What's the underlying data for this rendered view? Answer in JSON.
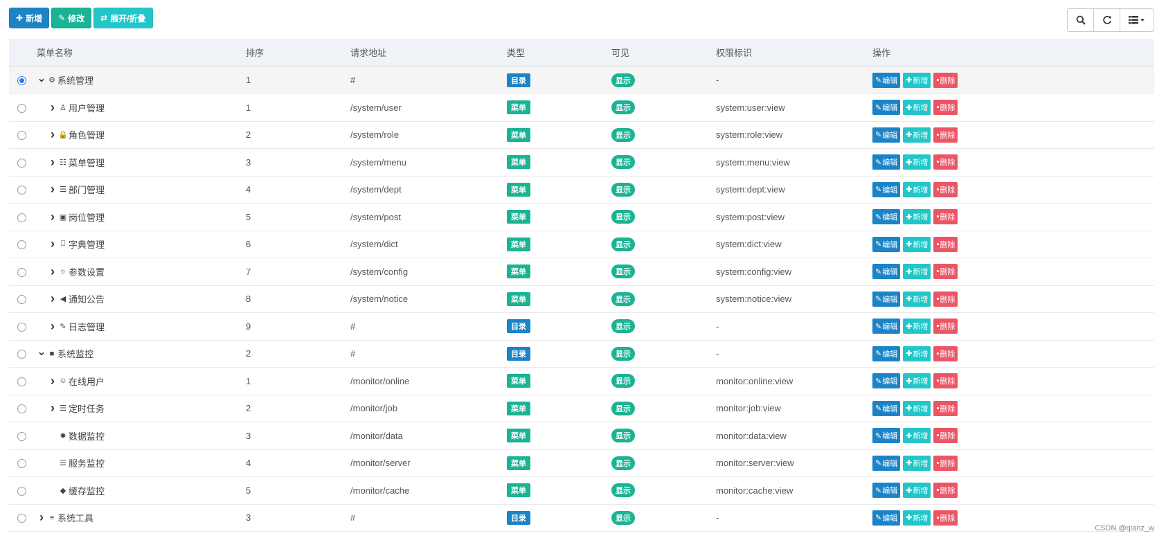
{
  "toolbar": {
    "add_label": "新增",
    "edit_label": "修改",
    "expand_label": "展开/折叠"
  },
  "right_tools": {
    "search_icon": "search-icon",
    "refresh_icon": "refresh-icon",
    "columns_icon": "columns-icon"
  },
  "columns": [
    "菜单名称",
    "排序",
    "请求地址",
    "类型",
    "可见",
    "权限标识",
    "操作"
  ],
  "actions": {
    "edit": "编辑",
    "add": "新增",
    "delete": "删除"
  },
  "rows": [
    {
      "level": 0,
      "toggle": "down",
      "icon": "gear-icon",
      "glyph": "⚙",
      "name": "系统管理",
      "order": "1",
      "url": "#",
      "type": "目录",
      "visible": "显示",
      "perm": "-",
      "selected": true
    },
    {
      "level": 1,
      "toggle": "right",
      "icon": "user-icon",
      "glyph": "♙",
      "name": "用户管理",
      "order": "1",
      "url": "/system/user",
      "type": "菜单",
      "visible": "显示",
      "perm": "system:user:view"
    },
    {
      "level": 1,
      "toggle": "right",
      "icon": "lock-icon",
      "glyph": "🔒",
      "name": "角色管理",
      "order": "2",
      "url": "/system/role",
      "type": "菜单",
      "visible": "显示",
      "perm": "system:role:view"
    },
    {
      "level": 1,
      "toggle": "right",
      "icon": "th-list-icon",
      "glyph": "☷",
      "name": "菜单管理",
      "order": "3",
      "url": "/system/menu",
      "type": "菜单",
      "visible": "显示",
      "perm": "system:menu:view"
    },
    {
      "level": 1,
      "toggle": "right",
      "icon": "outdent-icon",
      "glyph": "☰",
      "name": "部门管理",
      "order": "4",
      "url": "/system/dept",
      "type": "菜单",
      "visible": "显示",
      "perm": "system:dept:view"
    },
    {
      "level": 1,
      "toggle": "right",
      "icon": "id-card-icon",
      "glyph": "▣",
      "name": "岗位管理",
      "order": "5",
      "url": "/system/post",
      "type": "菜单",
      "visible": "显示",
      "perm": "system:post:view"
    },
    {
      "level": 1,
      "toggle": "right",
      "icon": "bookmark-icon",
      "glyph": "⎕",
      "name": "字典管理",
      "order": "6",
      "url": "/system/dict",
      "type": "菜单",
      "visible": "显示",
      "perm": "system:dict:view"
    },
    {
      "level": 1,
      "toggle": "right",
      "icon": "sun-icon",
      "glyph": "☼",
      "name": "参数设置",
      "order": "7",
      "url": "/system/config",
      "type": "菜单",
      "visible": "显示",
      "perm": "system:config:view"
    },
    {
      "level": 1,
      "toggle": "right",
      "icon": "bullhorn-icon",
      "glyph": "◀",
      "name": "通知公告",
      "order": "8",
      "url": "/system/notice",
      "type": "菜单",
      "visible": "显示",
      "perm": "system:notice:view"
    },
    {
      "level": 1,
      "toggle": "right",
      "icon": "edit-icon",
      "glyph": "✎",
      "name": "日志管理",
      "order": "9",
      "url": "#",
      "type": "目录",
      "visible": "显示",
      "perm": "-"
    },
    {
      "level": 0,
      "toggle": "down",
      "icon": "video-camera-icon",
      "glyph": "■",
      "name": "系统监控",
      "order": "2",
      "url": "#",
      "type": "目录",
      "visible": "显示",
      "perm": "-"
    },
    {
      "level": 1,
      "toggle": "right",
      "icon": "user-circle-icon",
      "glyph": "☺",
      "name": "在线用户",
      "order": "1",
      "url": "/monitor/online",
      "type": "菜单",
      "visible": "显示",
      "perm": "monitor:online:view"
    },
    {
      "level": 1,
      "toggle": "right",
      "icon": "tasks-icon",
      "glyph": "☰",
      "name": "定时任务",
      "order": "2",
      "url": "/monitor/job",
      "type": "菜单",
      "visible": "显示",
      "perm": "monitor:job:view"
    },
    {
      "level": 1,
      "toggle": "",
      "icon": "bug-icon",
      "glyph": "✹",
      "name": "数据监控",
      "order": "3",
      "url": "/monitor/data",
      "type": "菜单",
      "visible": "显示",
      "perm": "monitor:data:view"
    },
    {
      "level": 1,
      "toggle": "",
      "icon": "server-icon",
      "glyph": "☰",
      "name": "服务监控",
      "order": "4",
      "url": "/monitor/server",
      "type": "菜单",
      "visible": "显示",
      "perm": "monitor:server:view"
    },
    {
      "level": 1,
      "toggle": "",
      "icon": "cube-icon",
      "glyph": "◆",
      "name": "缓存监控",
      "order": "5",
      "url": "/monitor/cache",
      "type": "菜单",
      "visible": "显示",
      "perm": "monitor:cache:view"
    },
    {
      "level": 0,
      "toggle": "right",
      "icon": "bars-icon",
      "glyph": "≡",
      "name": "系统工具",
      "order": "3",
      "url": "#",
      "type": "目录",
      "visible": "显示",
      "perm": "-"
    }
  ],
  "colors": {
    "dir_badge": "#1c84c6",
    "menu_badge": "#1ab394",
    "edit": "#1c84c6",
    "add": "#23c6c8",
    "delete": "#ed5565"
  },
  "watermark": "CSDN @qianz_w"
}
